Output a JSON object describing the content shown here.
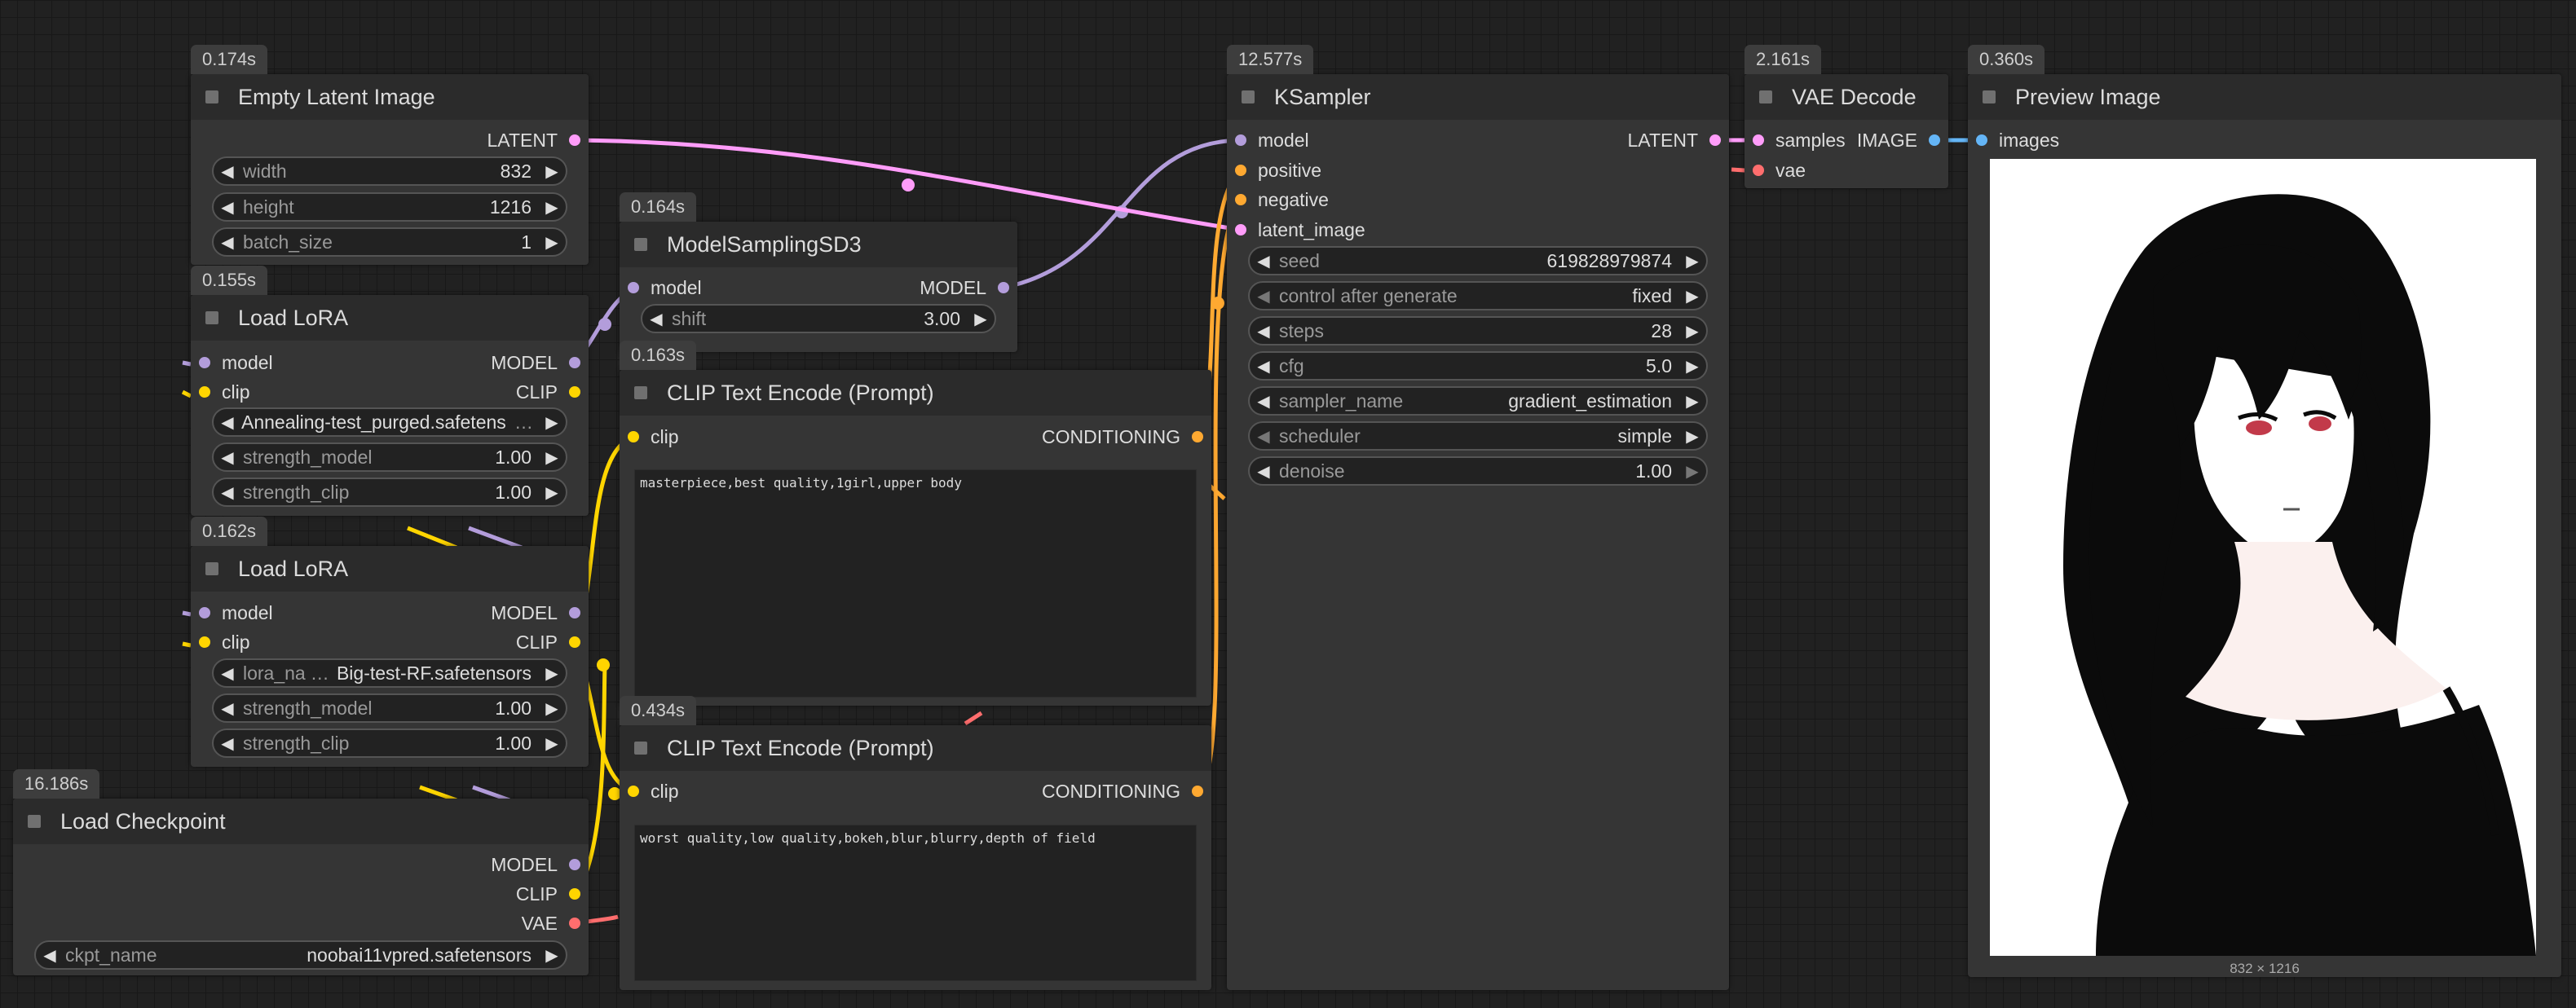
{
  "colors": {
    "latent": "#FF9CF9",
    "model": "#B39DDB",
    "clip": "#FFD500",
    "vae": "#FF6E6E",
    "conditioning": "#FFA931",
    "image": "#64B5F6",
    "canvas": "#212121",
    "node": "#353535"
  },
  "nodes": {
    "empty_latent": {
      "time": "0.174s",
      "title": "Empty Latent Image",
      "out_latent": "LATENT",
      "width_label": "width",
      "width_value": "832",
      "height_label": "height",
      "height_value": "1216",
      "batch_label": "batch_size",
      "batch_value": "1"
    },
    "lora1": {
      "time": "0.155s",
      "title": "Load LoRA",
      "in_model": "model",
      "in_clip": "clip",
      "out_model": "MODEL",
      "out_clip": "CLIP",
      "lora_value": "Annealing-test_purged.safetens",
      "sm_label": "strength_model",
      "sm_value": "1.00",
      "sc_label": "strength_clip",
      "sc_value": "1.00"
    },
    "lora2": {
      "time": "0.162s",
      "title": "Load LoRA",
      "in_model": "model",
      "in_clip": "clip",
      "out_model": "MODEL",
      "out_clip": "CLIP",
      "lora_label": "lora_na",
      "lora_value": "Big-test-RF.safetensors",
      "sm_label": "strength_model",
      "sm_value": "1.00",
      "sc_label": "strength_clip",
      "sc_value": "1.00"
    },
    "checkpoint": {
      "time": "16.186s",
      "title": "Load Checkpoint",
      "out_model": "MODEL",
      "out_clip": "CLIP",
      "out_vae": "VAE",
      "ckpt_label": "ckpt_name",
      "ckpt_value": "noobai11vpred.safetensors"
    },
    "model_sampling": {
      "time": "0.164s",
      "title": "ModelSamplingSD3",
      "in_model": "model",
      "out_model": "MODEL",
      "shift_label": "shift",
      "shift_value": "3.00"
    },
    "clip_pos": {
      "time": "0.163s",
      "title": "CLIP Text Encode (Prompt)",
      "in_clip": "clip",
      "out_cond": "CONDITIONING",
      "text": "masterpiece,best quality,1girl,upper body"
    },
    "clip_neg": {
      "time": "0.434s",
      "title": "CLIP Text Encode (Prompt)",
      "in_clip": "clip",
      "out_cond": "CONDITIONING",
      "text": "worst quality,low quality,bokeh,blur,blurry,depth of field"
    },
    "ksampler": {
      "time": "12.577s",
      "title": "KSampler",
      "in_model": "model",
      "in_positive": "positive",
      "in_negative": "negative",
      "in_latent": "latent_image",
      "out_latent": "LATENT",
      "seed_label": "seed",
      "seed_value": "619828979874",
      "cag_label": "control after generate",
      "cag_value": "fixed",
      "steps_label": "steps",
      "steps_value": "28",
      "cfg_label": "cfg",
      "cfg_value": "5.0",
      "sampler_label": "sampler_name",
      "sampler_value": "gradient_estimation",
      "scheduler_label": "scheduler",
      "scheduler_value": "simple",
      "denoise_label": "denoise",
      "denoise_value": "1.00"
    },
    "vae_decode": {
      "time": "2.161s",
      "title": "VAE Decode",
      "in_samples": "samples",
      "in_vae": "vae",
      "out_image": "IMAGE"
    },
    "preview": {
      "time": "0.360s",
      "title": "Preview Image",
      "in_images": "images",
      "size_caption": "832 × 1216"
    }
  }
}
